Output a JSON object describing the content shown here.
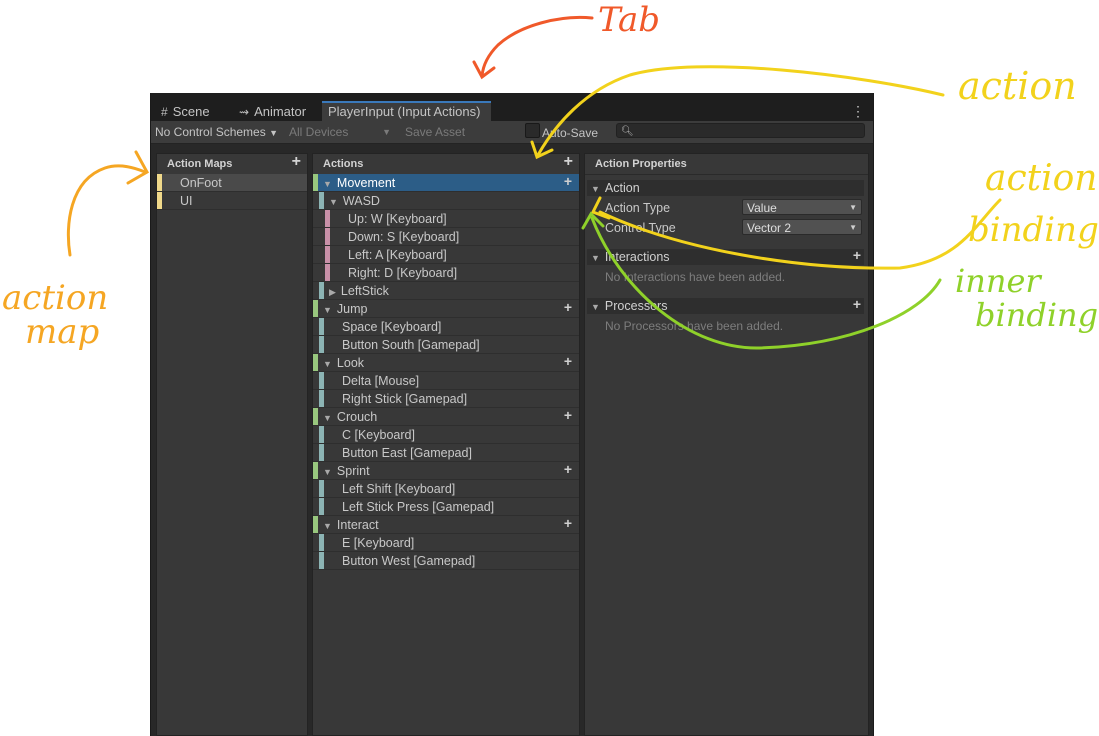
{
  "tabs": {
    "scene": "Scene",
    "animator": "Animator",
    "player_input": "PlayerInput (Input Actions)"
  },
  "toolbar": {
    "control_schemes": "No Control Schemes",
    "devices": "All Devices",
    "save_asset": "Save Asset",
    "auto_save": "Auto-Save",
    "search_placeholder": ""
  },
  "action_maps": {
    "header": "Action Maps",
    "items": [
      "OnFoot",
      "UI"
    ]
  },
  "actions": {
    "header": "Actions",
    "rows": [
      {
        "label": "Movement",
        "kind": "action"
      },
      {
        "label": "WASD",
        "kind": "composite"
      },
      {
        "label": "Up: W [Keyboard]",
        "kind": "part"
      },
      {
        "label": "Down: S [Keyboard]",
        "kind": "part"
      },
      {
        "label": "Left: A [Keyboard]",
        "kind": "part"
      },
      {
        "label": "Right: D [Keyboard]",
        "kind": "part"
      },
      {
        "label": "LeftStick",
        "kind": "composite-collapsed"
      },
      {
        "label": "Jump",
        "kind": "action"
      },
      {
        "label": "Space [Keyboard]",
        "kind": "binding"
      },
      {
        "label": "Button South [Gamepad]",
        "kind": "binding"
      },
      {
        "label": "Look",
        "kind": "action"
      },
      {
        "label": "Delta [Mouse]",
        "kind": "binding"
      },
      {
        "label": "Right Stick [Gamepad]",
        "kind": "binding"
      },
      {
        "label": "Crouch",
        "kind": "action"
      },
      {
        "label": "C [Keyboard]",
        "kind": "binding"
      },
      {
        "label": "Button East [Gamepad]",
        "kind": "binding"
      },
      {
        "label": "Sprint",
        "kind": "action"
      },
      {
        "label": "Left Shift [Keyboard]",
        "kind": "binding"
      },
      {
        "label": "Left Stick Press [Gamepad]",
        "kind": "binding"
      },
      {
        "label": "Interact",
        "kind": "action"
      },
      {
        "label": "E [Keyboard]",
        "kind": "binding"
      },
      {
        "label": "Button West [Gamepad]",
        "kind": "binding"
      }
    ]
  },
  "properties": {
    "header": "Action Properties",
    "action_section": "Action",
    "action_type_label": "Action Type",
    "action_type_value": "Value",
    "control_type_label": "Control Type",
    "control_type_value": "Vector 2",
    "interactions_section": "Interactions",
    "interactions_empty": "No Interactions have been added.",
    "processors_section": "Processors",
    "processors_empty": "No Processors have been added."
  },
  "annotations": {
    "tab": "Tab",
    "action": "action",
    "action_binding": [
      "action",
      "binding"
    ],
    "inner_binding": [
      "inner",
      "binding"
    ],
    "action_map": [
      "action",
      "map"
    ]
  },
  "colors": {
    "map_bar": "#f0d98a",
    "action_bar": "#98c77e",
    "binding_bar": "#8cb4b4",
    "part_bar": "#c890a8",
    "selected_row": "#2c5d87",
    "ann_orange": "#f0592a",
    "ann_yellow_orange": "#f5a623",
    "ann_yellow": "#f2d21c",
    "ann_green": "#8fd12a"
  }
}
